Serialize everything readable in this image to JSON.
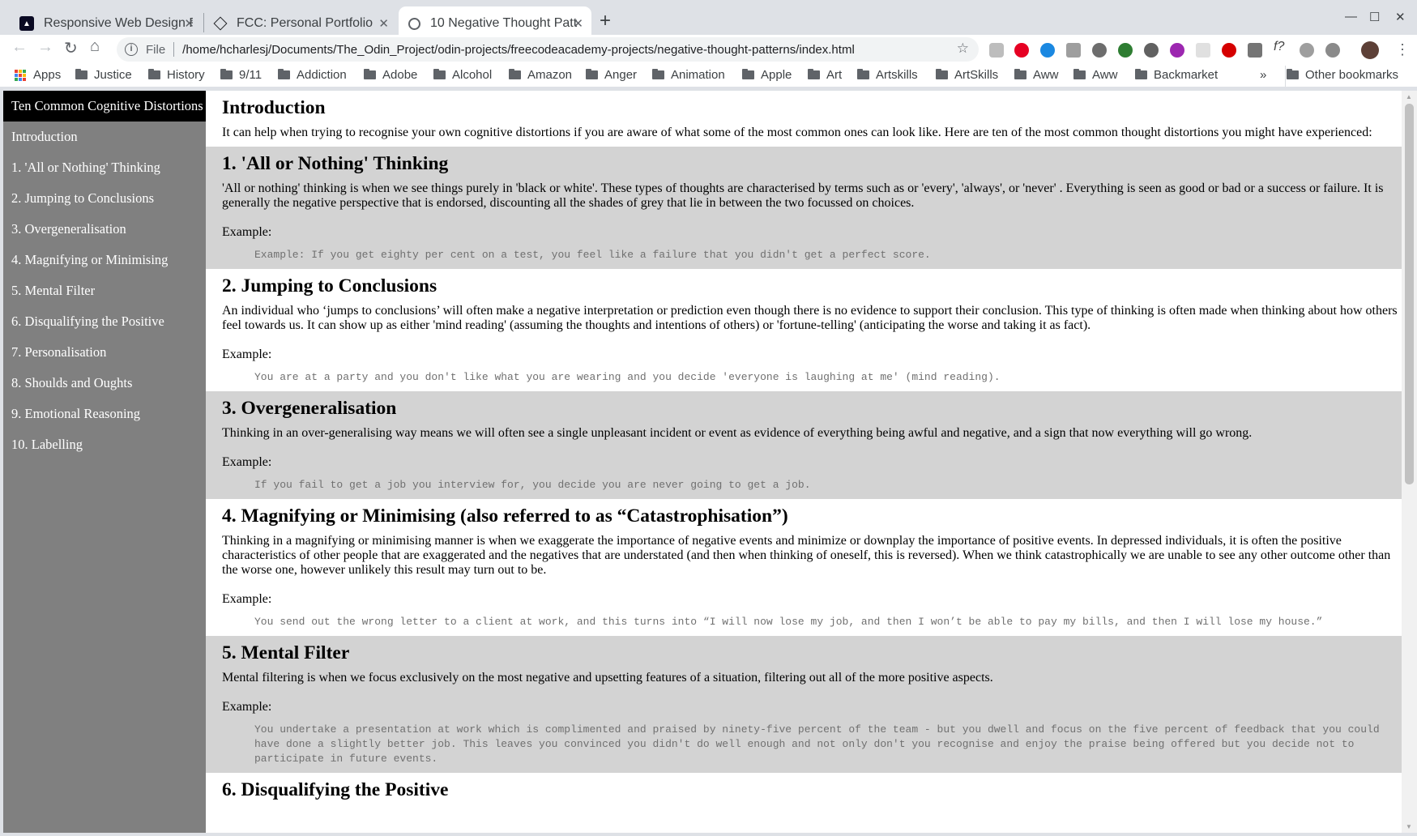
{
  "browser": {
    "tabs": [
      {
        "title": "Responsive Web Design P",
        "icon": "fcc-icon"
      },
      {
        "title": "FCC: Personal Portfolio",
        "icon": "codepen-icon"
      },
      {
        "title": "10 Negative Thought Patt",
        "icon": "globe-icon",
        "active": true
      }
    ],
    "address": {
      "scheme_label": "File",
      "url": "/home/hcharlesj/Documents/The_Odin_Project/odin-projects/freecodeacademy-projects/negative-thought-patterns/index.html"
    },
    "bookmarks": [
      "Apps",
      "Justice",
      "History",
      "9/11",
      "Addiction",
      "Adobe",
      "Alcohol",
      "Amazon",
      "Anger",
      "Animation",
      "Apple",
      "Art",
      "Artskills",
      "ArtSkills",
      "Aww",
      "Aww",
      "Backmarket"
    ],
    "overflow": "»",
    "other_bookmarks": "Other bookmarks"
  },
  "nav": {
    "header": "Ten Common Cognitive Distortions",
    "links": [
      "Introduction",
      "1. 'All or Nothing' Thinking",
      "2. Jumping to Conclusions",
      "3. Overgeneralisation",
      "4. Magnifying or Minimising",
      "5. Mental Filter",
      "6. Disqualifying the Positive",
      "7. Personalisation",
      "8. Shoulds and Oughts",
      "9. Emotional Reasoning",
      "10. Labelling"
    ]
  },
  "sections": [
    {
      "title": "Introduction",
      "text": "It can help when trying to recognise your own cognitive distortions if you are aware of what some of the most common ones can look like. Here are ten of the most common thought distortions you might have experienced:"
    },
    {
      "title": "1. 'All or Nothing' Thinking",
      "text": "'All or nothing' thinking is when we see things purely in 'black or white'. These types of thoughts are characterised by terms such as or 'every', 'always', or 'never' . Everything is seen as good or bad or a success or failure. It is generally the negative perspective that is endorsed, discounting all the shades of grey that lie in between the two focussed on choices.",
      "example_label": "Example:",
      "example": "Example: If you get eighty per cent on a test, you feel like a failure that you didn't get a perfect score."
    },
    {
      "title": "2. Jumping to Conclusions",
      "text": "An individual who ‘jumps to conclusions’ will often make a negative interpretation or prediction even though there is no evidence to support their conclusion. This type of thinking is often made when thinking about how others feel towards us. It can show up as either 'mind reading' (assuming the thoughts and intentions of others) or 'fortune-telling' (anticipating the worse and taking it as fact).",
      "example_label": "Example:",
      "example": "You are at a party and you don't like what you are wearing and you decide 'everyone is laughing at me' (mind reading)."
    },
    {
      "title": "3. Overgeneralisation",
      "text": "Thinking in an over-generalising way means we will often see a single unpleasant incident or event as evidence of everything being awful and negative, and a sign that now everything will go wrong.",
      "example_label": "Example:",
      "example": "If you fail to get a job you interview for, you decide you are never going to get a job."
    },
    {
      "title": "4. Magnifying or Minimising (also referred to as “Catastrophisation”)",
      "text": "Thinking in a magnifying or minimising manner is when we exaggerate the importance of negative events and minimize or downplay the importance of positive events. In depressed individuals, it is often the positive characteristics of other people that are exaggerated and the negatives that are understated (and then when thinking of oneself, this is reversed). When we think catastrophically we are unable to see any other outcome other than the worse one, however unlikely this result may turn out to be.",
      "example_label": "Example:",
      "example": "You send out the wrong letter to a client at work, and this turns into “I will now lose my job, and then I won’t be able to pay my bills, and then I will lose my house.”"
    },
    {
      "title": "5. Mental Filter",
      "text": "Mental filtering is when we focus exclusively on the most negative and upsetting features of a situation, filtering out all of the more positive aspects.",
      "example_label": "Example:",
      "example": "You undertake a presentation at work which is complimented and praised by ninety-five percent of the team - but you dwell and focus on the five percent of feedback that you could have done a slightly better job. This leaves you convinced you didn't do well enough and not only don't you recognise and enjoy the praise being offered but you decide not to participate in future events."
    },
    {
      "title": "6. Disqualifying the Positive"
    }
  ]
}
